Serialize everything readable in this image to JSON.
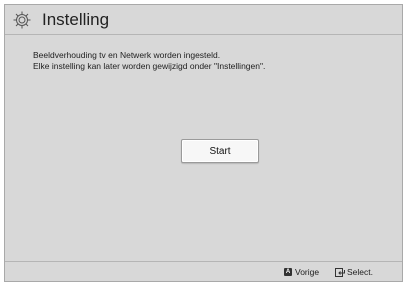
{
  "title": "Instelling",
  "message": {
    "line1": "Beeldverhouding tv en Netwerk worden ingesteld.",
    "line2": "Elke instelling kan later worden gewijzigd onder \"Instellingen\"."
  },
  "start_button": "Start",
  "footer": {
    "back_key": "A",
    "back_label": "Vorige",
    "select_label": "Select."
  },
  "icons": {
    "title": "gear-icon",
    "back": "a-key-icon",
    "select": "enter-icon"
  },
  "colors": {
    "background": "#d8d8d8",
    "button": "#f7f7f7",
    "text": "#1e1e1e"
  }
}
